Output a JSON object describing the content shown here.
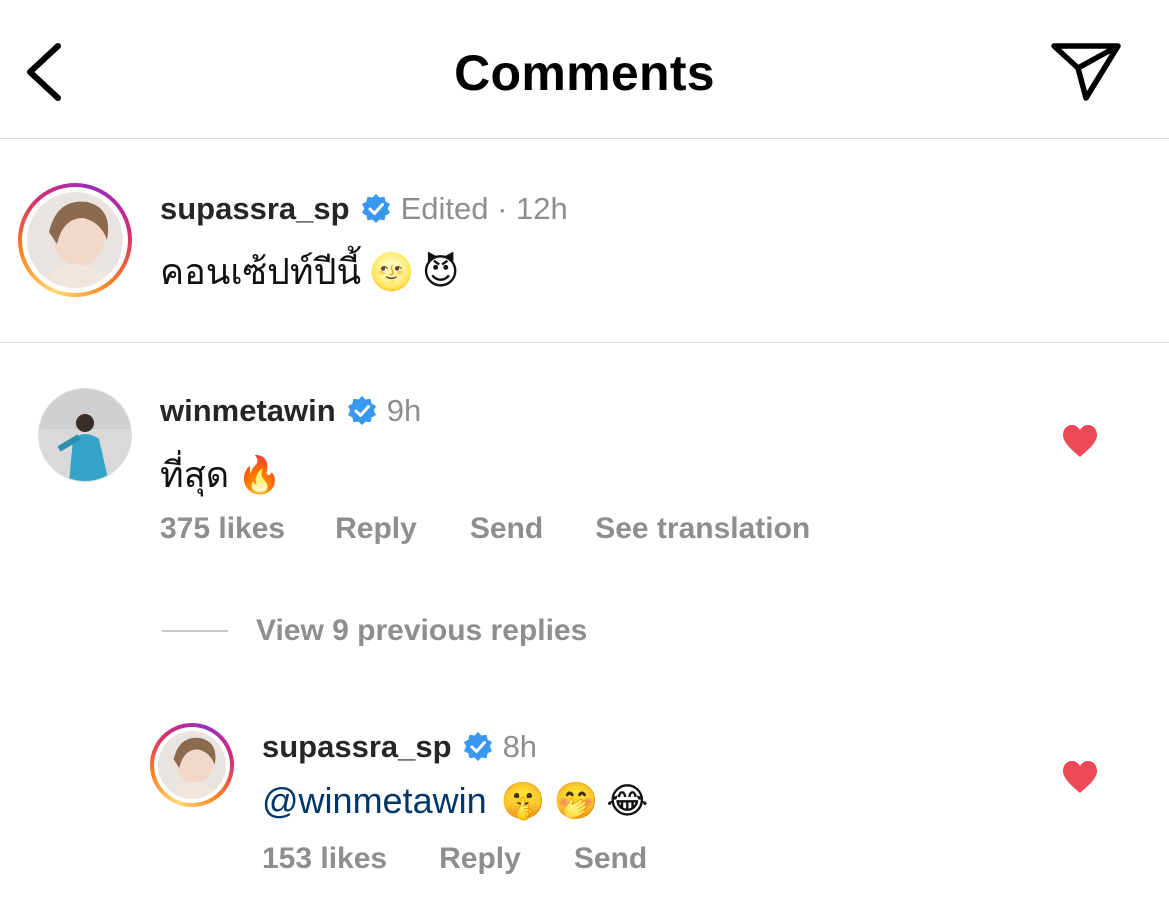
{
  "header": {
    "title": "Comments",
    "back_icon": "chevron-left-icon",
    "share_icon": "paper-plane-icon"
  },
  "caption": {
    "username": "supassra_sp",
    "meta": "Edited · 12h",
    "text": "คอนเซ้ปท์ปีนี้",
    "emojis": [
      "🌝",
      "😈"
    ]
  },
  "comment": {
    "username": "winmetawin",
    "time": "9h",
    "text": "ที่สุด",
    "emojis": [
      "🔥"
    ],
    "likes": "375 likes",
    "reply": "Reply",
    "send": "Send",
    "translate": "See translation",
    "liked": true
  },
  "view_replies": "View 9 previous replies",
  "reply": {
    "username": "supassra_sp",
    "time": "8h",
    "mention": "@winmetawin",
    "emojis": [
      "🤫",
      "🤭",
      "😂"
    ],
    "likes": "153 likes",
    "reply": "Reply",
    "send": "Send",
    "liked": true
  },
  "colors": {
    "verified": "#3897f0",
    "heart": "#ed4956",
    "mention": "#00376b",
    "secondary": "#8e8e8e"
  }
}
